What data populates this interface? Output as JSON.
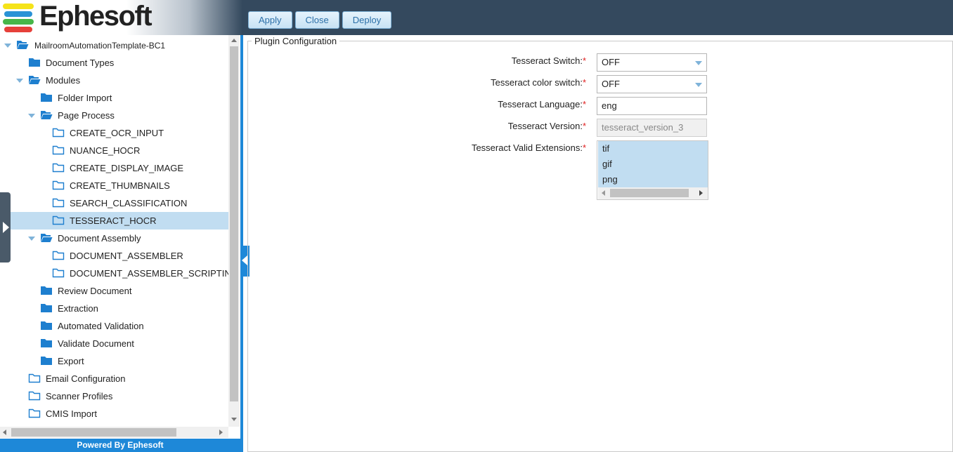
{
  "app": {
    "logo_text": "Ephesoft",
    "logo_colors": [
      "#f5e31a",
      "#2a92d6",
      "#47b649",
      "#e6403a"
    ],
    "accent": "#1e88d8",
    "header_bg": "#34495e"
  },
  "toolbar": {
    "apply_label": "Apply",
    "close_label": "Close",
    "deploy_label": "Deploy"
  },
  "tree": {
    "items": [
      {
        "label": "MailroomAutomationTemplate-BC1",
        "icon": "folder-open-icon",
        "expander": "down",
        "selected": false
      },
      {
        "label": "Document Types",
        "icon": "folder-icon",
        "expander": "right",
        "selected": false
      },
      {
        "label": "Modules",
        "icon": "folder-open-icon",
        "expander": "down",
        "selected": false
      },
      {
        "label": "Folder Import",
        "icon": "folder-icon",
        "expander": "right",
        "selected": false
      },
      {
        "label": "Page Process",
        "icon": "folder-open-icon",
        "expander": "down",
        "selected": false
      },
      {
        "label": "CREATE_OCR_INPUT",
        "icon": "folder-outline-icon",
        "expander": "none",
        "selected": false
      },
      {
        "label": "NUANCE_HOCR",
        "icon": "folder-outline-icon",
        "expander": "none",
        "selected": false
      },
      {
        "label": "CREATE_DISPLAY_IMAGE",
        "icon": "folder-outline-icon",
        "expander": "none",
        "selected": false
      },
      {
        "label": "CREATE_THUMBNAILS",
        "icon": "folder-outline-icon",
        "expander": "none",
        "selected": false
      },
      {
        "label": "SEARCH_CLASSIFICATION",
        "icon": "folder-outline-icon",
        "expander": "none",
        "selected": false
      },
      {
        "label": "TESSERACT_HOCR",
        "icon": "folder-outline-icon",
        "expander": "none",
        "selected": true
      },
      {
        "label": "Document Assembly",
        "icon": "folder-open-icon",
        "expander": "down",
        "selected": false
      },
      {
        "label": "DOCUMENT_ASSEMBLER",
        "icon": "folder-outline-icon",
        "expander": "none",
        "selected": false
      },
      {
        "label": "DOCUMENT_ASSEMBLER_SCRIPTING",
        "icon": "folder-outline-icon",
        "expander": "none",
        "selected": false
      },
      {
        "label": "Review Document",
        "icon": "folder-icon",
        "expander": "right",
        "selected": false
      },
      {
        "label": "Extraction",
        "icon": "folder-icon",
        "expander": "right",
        "selected": false
      },
      {
        "label": "Automated Validation",
        "icon": "folder-icon",
        "expander": "right",
        "selected": false
      },
      {
        "label": "Validate Document",
        "icon": "folder-icon",
        "expander": "right",
        "selected": false
      },
      {
        "label": "Export",
        "icon": "folder-icon",
        "expander": "right",
        "selected": false
      },
      {
        "label": "Email Configuration",
        "icon": "folder-outline-icon",
        "expander": "none",
        "selected": false
      },
      {
        "label": "Scanner Profiles",
        "icon": "folder-outline-icon",
        "expander": "none",
        "selected": false
      },
      {
        "label": "CMIS Import",
        "icon": "folder-outline-icon",
        "expander": "none",
        "selected": false
      }
    ]
  },
  "footer": {
    "text": "Powered By Ephesoft"
  },
  "config": {
    "legend": "Plugin Configuration",
    "required_mark": "*",
    "fields": {
      "switch_label": "Tesseract Switch:",
      "switch_value": "OFF",
      "color_switch_label": "Tesseract color switch:",
      "color_switch_value": "OFF",
      "language_label": "Tesseract Language:",
      "language_value": "eng",
      "version_label": "Tesseract Version:",
      "version_value": "tesseract_version_3",
      "extensions_label": "Tesseract Valid Extensions:",
      "extensions": [
        "tif",
        "gif",
        "png"
      ]
    }
  }
}
